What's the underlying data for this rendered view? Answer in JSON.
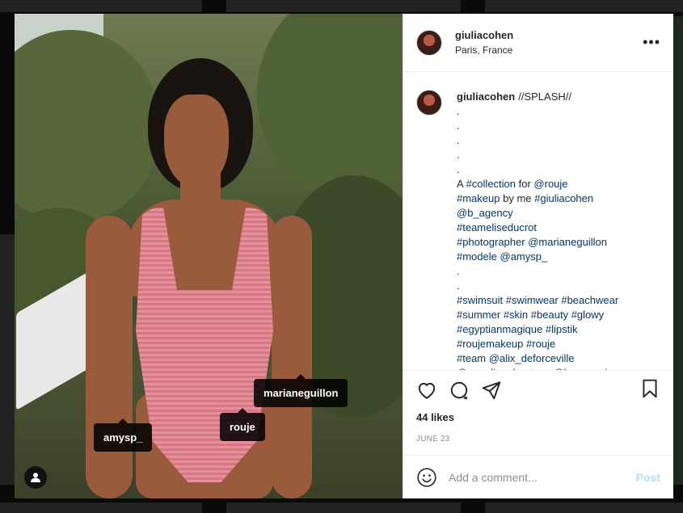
{
  "post": {
    "username": "giuliacohen",
    "location": "Paris, France",
    "more_label": "•••",
    "caption_username": "giuliacohen",
    "caption_lines": [
      {
        "text": "//SPLASH//",
        "first": true
      },
      {
        "text": "."
      },
      {
        "text": "."
      },
      {
        "text": "."
      },
      {
        "text": "."
      },
      {
        "text": "."
      },
      {
        "parts": [
          {
            "t": "A "
          },
          {
            "t": "#collection",
            "tag": true
          },
          {
            "t": " for "
          },
          {
            "t": "@rouje",
            "tag": true
          }
        ]
      },
      {
        "parts": [
          {
            "t": "#makeup",
            "tag": true
          },
          {
            "t": " by me "
          },
          {
            "t": "#giuliacohen",
            "tag": true
          }
        ]
      },
      {
        "parts": [
          {
            "t": "@b_agency",
            "tag": true
          }
        ]
      },
      {
        "parts": [
          {
            "t": "#teameliseducrot",
            "tag": true
          }
        ]
      },
      {
        "parts": [
          {
            "t": "#photographer",
            "tag": true
          },
          {
            "t": " "
          },
          {
            "t": "@marianeguillon",
            "tag": true
          }
        ]
      },
      {
        "parts": [
          {
            "t": "#modele",
            "tag": true
          },
          {
            "t": " "
          },
          {
            "t": "@amysp_",
            "tag": true
          }
        ]
      },
      {
        "text": "."
      },
      {
        "text": "."
      },
      {
        "parts": [
          {
            "t": "#swimsuit",
            "tag": true
          },
          {
            "t": " "
          },
          {
            "t": "#swimwear",
            "tag": true
          },
          {
            "t": " "
          },
          {
            "t": "#beachwear",
            "tag": true
          }
        ]
      },
      {
        "parts": [
          {
            "t": "#summer",
            "tag": true
          },
          {
            "t": " "
          },
          {
            "t": "#skin",
            "tag": true
          },
          {
            "t": " "
          },
          {
            "t": "#beauty",
            "tag": true
          },
          {
            "t": " "
          },
          {
            "t": "#glowy",
            "tag": true
          }
        ]
      },
      {
        "parts": [
          {
            "t": "#egyptianmagique",
            "tag": true
          },
          {
            "t": " "
          },
          {
            "t": "#lipstik",
            "tag": true
          }
        ]
      },
      {
        "parts": [
          {
            "t": "#roujemakeup",
            "tag": true
          },
          {
            "t": " "
          },
          {
            "t": "#rouje",
            "tag": true
          }
        ]
      },
      {
        "parts": [
          {
            "t": "#team",
            "tag": true
          },
          {
            "t": " "
          },
          {
            "t": "@alix_deforceville",
            "tag": true
          }
        ]
      },
      {
        "parts": [
          {
            "t": "@angeliquehentoux",
            "tag": true
          },
          {
            "t": " "
          },
          {
            "t": "@lournanais",
            "tag": true
          }
        ]
      }
    ],
    "likes": "44 likes",
    "date": "JUNE 23",
    "comment_placeholder": "Add a comment...",
    "post_label": "Post"
  },
  "photo_tags": {
    "tag1": "marianeguillon",
    "tag2": "rouje",
    "tag3": "amysp_"
  },
  "icons": [
    "heart-icon",
    "comment-icon",
    "share-icon",
    "bookmark-icon",
    "emoji-icon",
    "user-tags-icon"
  ],
  "colors": {
    "link": "#00376b",
    "post_button": "#b2dffc",
    "muted": "#8e8e8e"
  }
}
